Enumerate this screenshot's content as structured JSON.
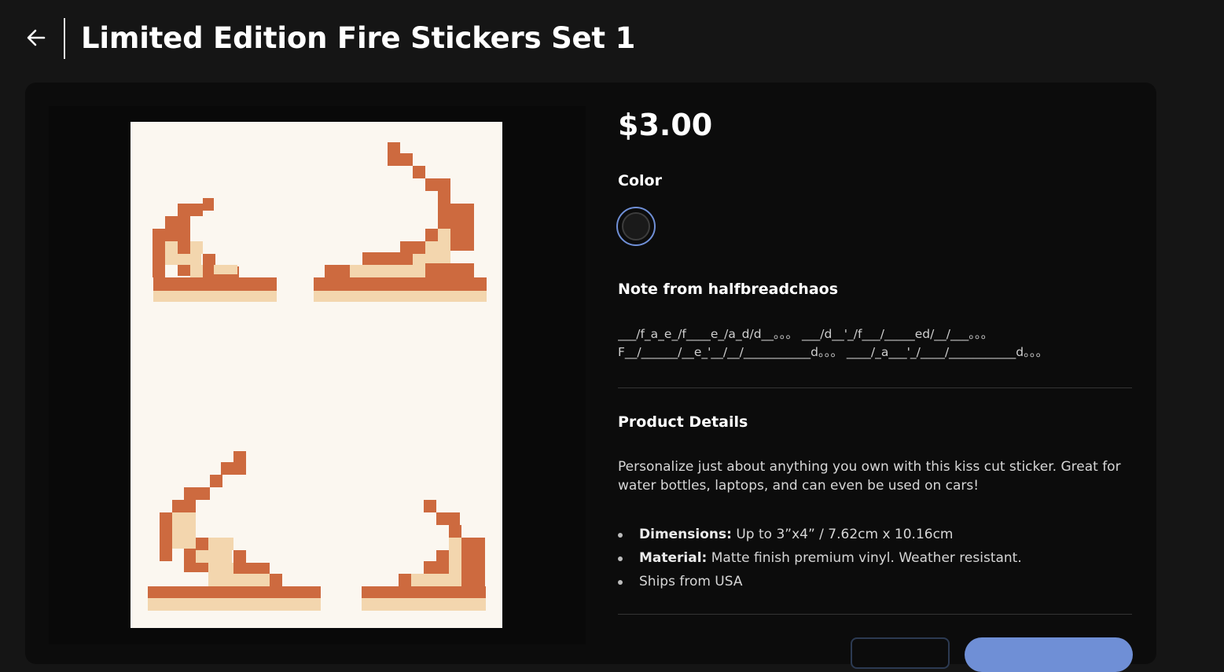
{
  "header": {
    "title": "Limited Edition Fire Stickers Set 1"
  },
  "product": {
    "price": "$3.00",
    "color_label": "Color",
    "note_label": "Note from halfbreadchaos",
    "note_lines": [
      "___/f_a_e_/f____e_/a_d/d__。。。 ___/d__'_/f___/_____ed/__/___。。。",
      "F__/______/__e_'__/__/___________d。。。 ____/_a___'_/____/___________d。。。"
    ],
    "details_label": "Product Details",
    "description": "Personalize just about anything you own with this kiss cut sticker. Great for water bottles, laptops, and can even be used on cars!",
    "bullets": [
      {
        "label": "Dimensions:",
        "text": " Up to 3”x4” / 7.62cm x 10.16cm"
      },
      {
        "label": "Material:",
        "text": " Matte finish premium vinyl. Weather resistant."
      },
      {
        "label": "",
        "text": "Ships from USA"
      }
    ]
  },
  "colors": {
    "background": "#151515",
    "card": "#0c0c0c",
    "sheet": "#fbf7f0",
    "flame_dark": "#cd6a3f",
    "flame_light": "#f3d6ae",
    "accent": "#6f8fd6"
  }
}
